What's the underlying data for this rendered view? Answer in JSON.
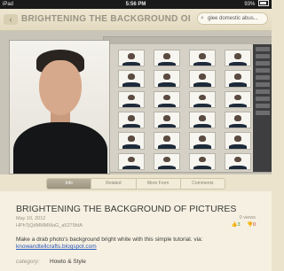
{
  "status_bar": {
    "carrier": "iPad",
    "time": "5:56 PM",
    "battery": "93%"
  },
  "header": {
    "title": "BRIGHTENING THE BACKGROUND OF PI",
    "search_value": "glee domestic abus..."
  },
  "tabs": [
    "Info",
    "Related",
    "More From",
    "Comments"
  ],
  "video": {
    "title": "BRIGHTENING THE BACKGROUND OF PICTURES",
    "date": "May 10, 2012",
    "id": "HPhTjQdMMMMaG_a5279IdA",
    "views": "0 views",
    "likes": "3",
    "dislikes": "0",
    "description": "Make a drab photo's background bright white with this simple tutorial. via:",
    "link": "knowandtellcrafts.blogspot.com",
    "category_label": "category:",
    "category_value": "Howto & Style"
  }
}
